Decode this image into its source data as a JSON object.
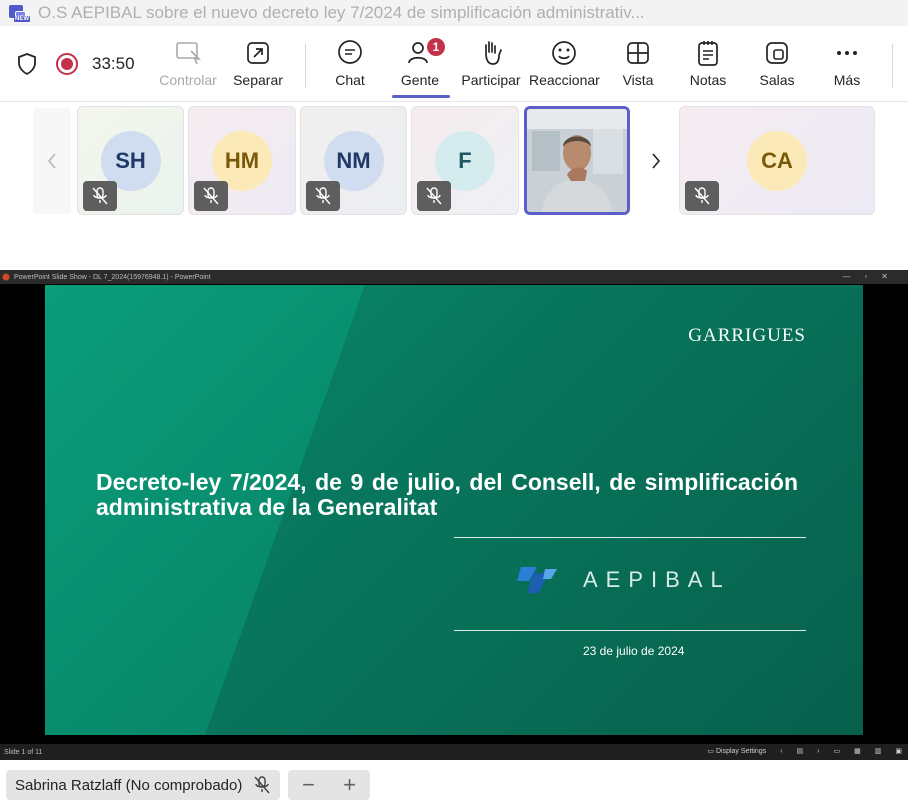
{
  "window": {
    "title": "O.S AEPIBAL sobre el nuevo decreto ley 7/2024 de simplificación administrativ...",
    "app_icon": "teams-icon"
  },
  "toolbar": {
    "timer": "33:50",
    "buttons": [
      {
        "label": "Controlar",
        "icon": "share-control-icon",
        "disabled": true
      },
      {
        "label": "Separar",
        "icon": "pop-out-icon"
      },
      {
        "label": "Chat",
        "icon": "chat-icon"
      },
      {
        "label": "Gente",
        "icon": "people-icon",
        "badge": "1",
        "active": true
      },
      {
        "label": "Participar",
        "icon": "raise-hand-icon"
      },
      {
        "label": "Reaccionar",
        "icon": "smile-icon"
      },
      {
        "label": "Vista",
        "icon": "grid-view-icon"
      },
      {
        "label": "Notas",
        "icon": "notes-icon"
      },
      {
        "label": "Salas",
        "icon": "rooms-icon"
      },
      {
        "label": "Más",
        "icon": "more-icon"
      }
    ],
    "accent": "#5b5fc7"
  },
  "participants": [
    {
      "initials": "SH",
      "bg": "#d0dcef",
      "fg": "#1f3a66",
      "muted": true
    },
    {
      "initials": "HM",
      "bg": "#fbe9b7",
      "fg": "#7a5a0a",
      "muted": true
    },
    {
      "initials": "NM",
      "bg": "#d0dcef",
      "fg": "#1f3a66",
      "muted": true
    },
    {
      "initials": "F",
      "bg": "#d5ecef",
      "fg": "#1c5961",
      "muted": true
    },
    {
      "initials": "",
      "video": true
    },
    {
      "initials": "CA",
      "bg": "#fbe9b7",
      "fg": "#7a5a0a",
      "muted": true
    }
  ],
  "ppt": {
    "window_title": "PowerPoint Slide Show  -  DL 7_2024(15976948.1) - PowerPoint",
    "status_left": "Slide 1 of 11",
    "display_settings": "Display Settings"
  },
  "slide": {
    "brand": "GARRIGUES",
    "title": "Decreto-ley 7/2024, de 9 de julio, del Consell, de simplificación administrativa de la Generalitat",
    "partner": "AEPIBAL",
    "date": "23 de julio de 2024"
  },
  "presenter": {
    "name": "Sabrina Ratzlaff (No comprobado)"
  },
  "zoom": {
    "minus": "−",
    "plus": "+"
  }
}
